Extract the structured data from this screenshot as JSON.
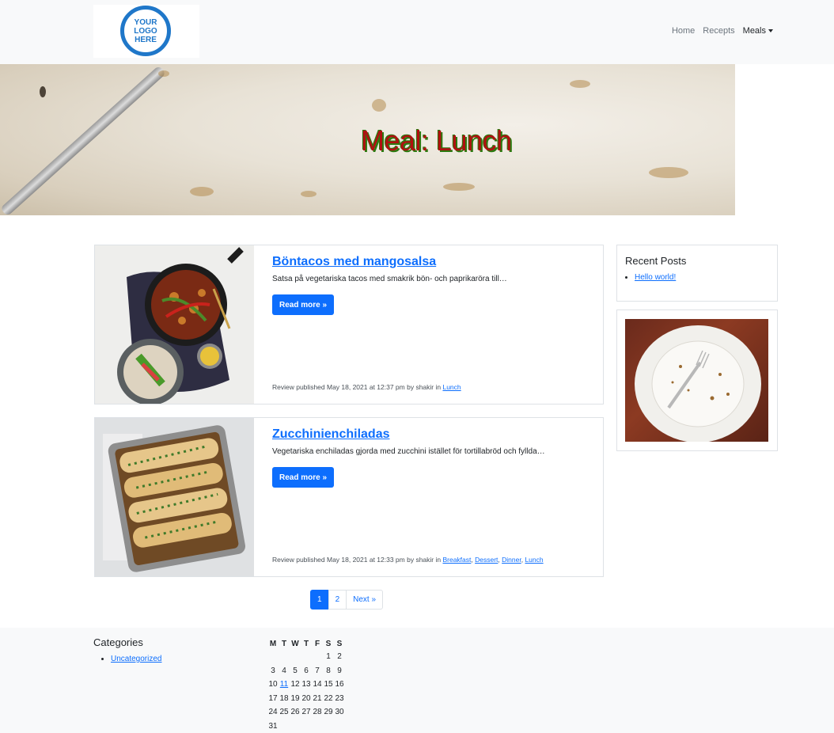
{
  "brand": {
    "logo_text": "YOUR\nLOGO\nHERE"
  },
  "nav": {
    "home": "Home",
    "recepts": "Recepts",
    "meals": "Meals"
  },
  "hero": {
    "title": "Meal: Lunch"
  },
  "posts": [
    {
      "title": "Böntacos med mangosalsa",
      "excerpt": "Satsa på vegetariska tacos med smakrik bön- och paprikaröra till…",
      "button": "Read more »",
      "meta_prefix": "Review published May 18, 2021 at 12:37 pm by shakir in ",
      "categories": [
        "Lunch"
      ]
    },
    {
      "title": "Zucchinienchiladas",
      "excerpt": "Vegetariska enchiladas gjorda med zucchini istället för tortillabröd och fyllda…",
      "button": "Read more »",
      "meta_prefix": "Review published May 18, 2021 at 12:33 pm by shakir in ",
      "categories": [
        "Breakfast",
        "Dessert",
        "Dinner",
        "Lunch"
      ],
      "sep": ", "
    }
  ],
  "sidebar": {
    "recent_title": "Recent Posts",
    "recent_items": [
      "Hello world!"
    ]
  },
  "pagination": {
    "page1": "1",
    "page2": "2",
    "next": "Next »"
  },
  "footer": {
    "categories_title": "Categories",
    "categories": [
      "Uncategorized"
    ],
    "calendar": {
      "headers": [
        "M",
        "T",
        "W",
        "T",
        "F",
        "S",
        "S"
      ],
      "rows": [
        [
          "",
          "",
          "",
          "",
          "",
          "1",
          "2"
        ],
        [
          "3",
          "4",
          "5",
          "6",
          "7",
          "8",
          "9"
        ],
        [
          "10",
          "11",
          "12",
          "13",
          "14",
          "15",
          "16"
        ],
        [
          "17",
          "18",
          "19",
          "20",
          "21",
          "22",
          "23"
        ],
        [
          "24",
          "25",
          "26",
          "27",
          "28",
          "29",
          "30"
        ],
        [
          "31",
          "",
          "",
          "",
          "",
          "",
          ""
        ]
      ],
      "linked_day": "11"
    }
  },
  "colors": {
    "primary": "#0d6efd",
    "hero_title": "#b01010",
    "hero_shadow": "#2c7a10"
  }
}
